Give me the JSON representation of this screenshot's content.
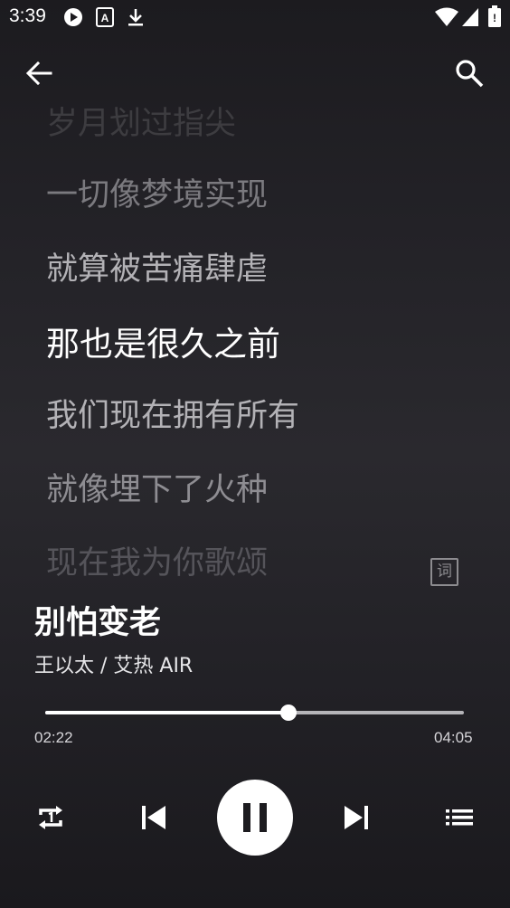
{
  "status_bar": {
    "time": "3:39"
  },
  "lyrics": {
    "lines": [
      "岁月划过指尖",
      "一切像梦境实现",
      "就算被苦痛肆虐",
      "那也是很久之前",
      "我们现在拥有所有",
      "就像埋下了火种",
      "现在我为你歌颂"
    ],
    "current_index": 3,
    "lyric_toggle_label": "词"
  },
  "song": {
    "title": "别怕变老",
    "artist": "王以太 / 艾热 AIR"
  },
  "playback": {
    "current_time": "02:22",
    "total_time": "04:05",
    "progress": 0.58
  },
  "colors": {
    "active_lyric": "#ffffff",
    "inactive_lyric": "#a9a8ac",
    "accent": "#ffffff"
  }
}
